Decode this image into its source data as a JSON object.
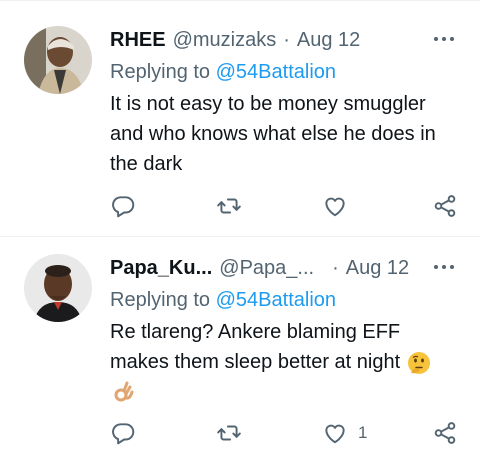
{
  "tweets": [
    {
      "name": "RHEE",
      "handle": "@muzizaks",
      "separator": "·",
      "date": "Aug 12",
      "replying_prefix": "Replying to",
      "replying_to": "@54Battalion",
      "text": "It is not easy to be money smuggler and who knows what else he does in the dark",
      "likes": ""
    },
    {
      "name": "Papa_Ku...",
      "handle": "@Papa_...",
      "separator": "·",
      "date": "Aug 12",
      "replying_prefix": "Replying to",
      "replying_to": "@54Battalion",
      "text": "Re tlareng? Ankere blaming EFF makes them sleep better at night",
      "likes": "1"
    }
  ],
  "icons": {
    "more": "more-dots-icon",
    "reply": "reply-icon",
    "retweet": "retweet-icon",
    "like": "heart-icon",
    "share": "share-icon",
    "emoji_1": "thinking-face-emoji",
    "emoji_2": "ok-hand-emoji"
  },
  "colors": {
    "mention": "#1d9bf0",
    "secondary_text": "#536471",
    "divider": "#eff3f4"
  }
}
